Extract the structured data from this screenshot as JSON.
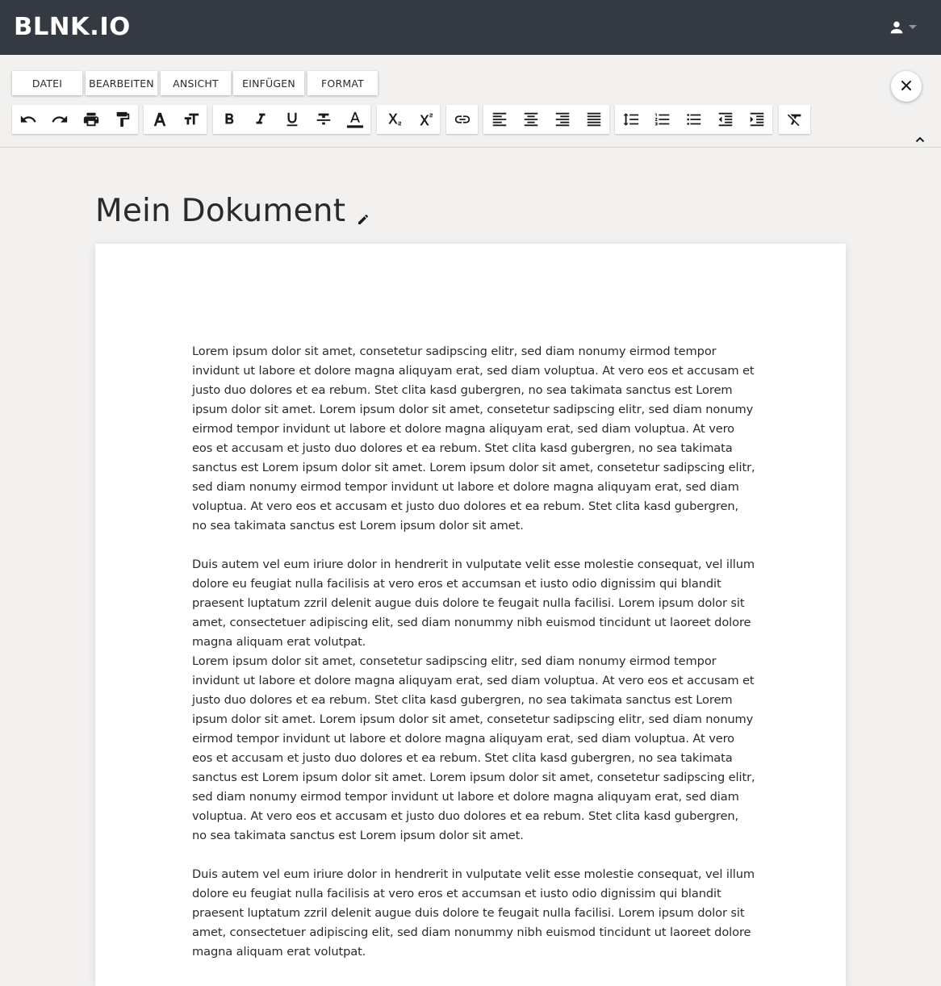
{
  "app": {
    "logo": "BLNK.IO"
  },
  "header": {
    "user_icon": "user-icon",
    "dropdown_icon": "caret-down-icon"
  },
  "menu": [
    {
      "label": "DATEI"
    },
    {
      "label": "BEARBEITEN"
    },
    {
      "label": "ANSICHT"
    },
    {
      "label": "EINFÜGEN"
    },
    {
      "label": "FORMAT"
    }
  ],
  "toolbar": {
    "groups": [
      [
        "undo-icon",
        "redo-icon",
        "print-icon",
        "format-painter-icon"
      ],
      [
        "font-family-icon",
        "font-size-icon"
      ],
      [
        "bold-icon",
        "italic-icon",
        "underline-icon",
        "strikethrough-icon",
        "text-color-icon"
      ],
      [
        "subscript-icon",
        "superscript-icon"
      ],
      [
        "link-icon"
      ],
      [
        "align-left-icon",
        "align-center-icon",
        "align-right-icon",
        "align-justify-icon"
      ],
      [
        "line-height-icon",
        "numbered-list-icon",
        "bullet-list-icon",
        "outdent-icon",
        "indent-icon"
      ],
      [
        "clear-formatting-icon"
      ]
    ],
    "close_icon": "close-icon",
    "collapse_icon": "chevron-up-icon",
    "text_color": "#1a1a1a"
  },
  "document": {
    "title": "Mein Dokument",
    "edit_icon": "pencil-icon",
    "paragraphs": [
      "Lorem ipsum dolor sit amet, consetetur sadipscing elitr, sed diam nonumy eirmod tempor invidunt ut labore et dolore magna aliquyam erat, sed diam voluptua. At vero eos et accusam et justo duo dolores et ea rebum. Stet clita kasd gubergren, no sea takimata sanctus est Lorem ipsum dolor sit amet. Lorem ipsum dolor sit amet, consetetur sadipscing elitr, sed diam nonumy eirmod tempor invidunt ut labore et dolore magna aliquyam erat, sed diam voluptua. At vero eos et accusam et justo duo dolores et ea rebum. Stet clita kasd gubergren, no sea takimata sanctus est Lorem ipsum dolor sit amet. Lorem ipsum dolor sit amet, consetetur sadipscing elitr, sed diam nonumy eirmod tempor invidunt ut labore et dolore magna aliquyam erat, sed diam voluptua. At vero eos et accusam et justo duo dolores et ea rebum. Stet clita kasd gubergren, no sea takimata sanctus est Lorem ipsum dolor sit amet.",
      "Duis autem vel eum iriure dolor in hendrerit in vulputate velit esse molestie consequat, vel illum dolore eu feugiat nulla facilisis at vero eros et accumsan et iusto odio dignissim qui blandit praesent luptatum zzril delenit augue duis dolore te feugait nulla facilisi. Lorem ipsum dolor sit amet, consectetuer adipiscing elit, sed diam nonummy nibh euismod tincidunt ut laoreet dolore magna aliquam erat volutpat.",
      "Lorem ipsum dolor sit amet, consetetur sadipscing elitr, sed diam nonumy eirmod tempor invidunt ut labore et dolore magna aliquyam erat, sed diam voluptua. At vero eos et accusam et justo duo dolores et ea rebum. Stet clita kasd gubergren, no sea takimata sanctus est Lorem ipsum dolor sit amet. Lorem ipsum dolor sit amet, consetetur sadipscing elitr, sed diam nonumy eirmod tempor invidunt ut labore et dolore magna aliquyam erat, sed diam voluptua. At vero eos et accusam et justo duo dolores et ea rebum. Stet clita kasd gubergren, no sea takimata sanctus est Lorem ipsum dolor sit amet. Lorem ipsum dolor sit amet, consetetur sadipscing elitr, sed diam nonumy eirmod tempor invidunt ut labore et dolore magna aliquyam erat, sed diam voluptua. At vero eos et accusam et justo duo dolores et ea rebum. Stet clita kasd gubergren, no sea takimata sanctus est Lorem ipsum dolor sit amet.",
      "Duis autem vel eum iriure dolor in hendrerit in vulputate velit esse molestie consequat, vel illum dolore eu feugiat nulla facilisis at vero eros et accumsan et iusto odio dignissim qui blandit praesent luptatum zzril delenit augue duis dolore te feugait nulla facilisi. Lorem ipsum dolor sit amet, consectetuer adipiscing elit, sed diam nonummy nibh euismod tincidunt ut laoreet dolore magna aliquam erat volutpat."
    ]
  }
}
